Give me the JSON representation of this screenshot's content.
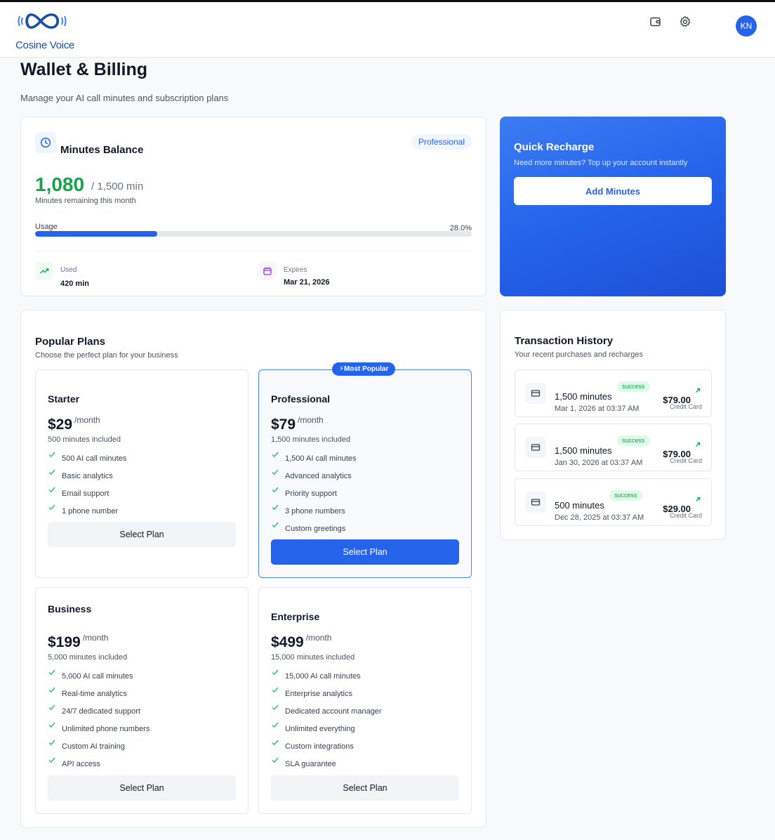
{
  "app": {
    "name": "Cosine Voice",
    "user_initials": "KN"
  },
  "header": {
    "icons": [
      "wallet-icon",
      "gear-icon"
    ]
  },
  "page": {
    "title": "Wallet & Billing",
    "subtitle": "Manage your AI call minutes and subscription plans"
  },
  "balance": {
    "title": "Minutes Balance",
    "plan_badge": "Professional",
    "remaining": "1,080",
    "total": "/ 1,500 min",
    "remaining_label": "Minutes remaining this month",
    "usage_label": "Usage",
    "usage_percent_text": "28.0%",
    "usage_fraction": 0.28,
    "used_label": "Used",
    "used_value": "420 min",
    "expires_label": "Expires",
    "expires_value": "Mar 21, 2026"
  },
  "recharge": {
    "title": "Quick Recharge",
    "subtitle": "Need more minutes? Top up your account instantly",
    "button": "Add Minutes"
  },
  "plans": {
    "title": "Popular Plans",
    "subtitle": "Choose the perfect plan for your business",
    "popular_badge": "Most Popular",
    "items": [
      {
        "name": "Starter",
        "price": "$29",
        "period": "/month",
        "included": "500 minutes included",
        "features": [
          "500 AI call minutes",
          "Basic analytics",
          "Email support",
          "1 phone number"
        ],
        "button": "Select Plan"
      },
      {
        "name": "Professional",
        "price": "$79",
        "period": "/month",
        "included": "1,500 minutes included",
        "features": [
          "1,500 AI call minutes",
          "Advanced analytics",
          "Priority support",
          "3 phone numbers",
          "Custom greetings"
        ],
        "button": "Select Plan"
      },
      {
        "name": "Business",
        "price": "$199",
        "period": "/month",
        "included": "5,000 minutes included",
        "features": [
          "5,000 AI call minutes",
          "Real-time analytics",
          "24/7 dedicated support",
          "Unlimited phone numbers",
          "Custom AI training",
          "API access"
        ],
        "button": "Select Plan"
      },
      {
        "name": "Enterprise",
        "price": "$499",
        "period": "/month",
        "included": "15,000 minutes included",
        "features": [
          "15,000 AI call minutes",
          "Enterprise analytics",
          "Dedicated account manager",
          "Unlimited everything",
          "Custom integrations",
          "SLA guarantee"
        ],
        "button": "Select Plan"
      }
    ]
  },
  "transactions": {
    "title": "Transaction History",
    "subtitle": "Your recent purchases and recharges",
    "items": [
      {
        "name": "1,500 minutes",
        "date": "Mar 1, 2026 at 03:37 AM",
        "status": "success",
        "amount": "$79.00",
        "method": "Credit Card"
      },
      {
        "name": "1,500 minutes",
        "date": "Jan 30, 2026 at 03:37 AM",
        "status": "success",
        "amount": "$79.00",
        "method": "Credit Card"
      },
      {
        "name": "500 minutes",
        "date": "Dec 28, 2025 at 03:37 AM",
        "status": "success",
        "amount": "$29.00",
        "method": "Credit Card"
      }
    ]
  },
  "colors": {
    "accent": "#2563eb",
    "success": "#16a34a",
    "brand_text": "#1d4fa8"
  }
}
